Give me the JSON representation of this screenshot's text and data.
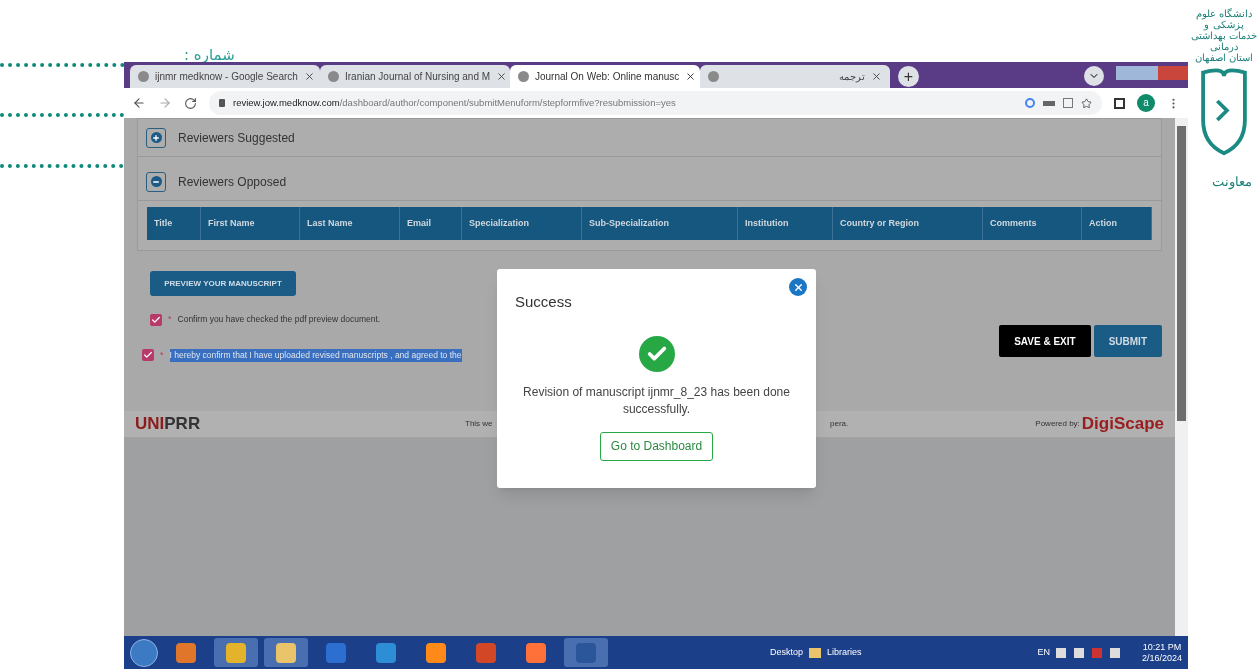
{
  "letterhead": {
    "number_label": "شماره :",
    "logo_lines": [
      "دانشگاه علوم پزشکی و خدمات بهداشتی درمانی",
      "استان اصفهان"
    ],
    "side_text": "معاونت"
  },
  "browser": {
    "tabs": [
      {
        "title": "ijnmr medknow - Google Search",
        "selected": false
      },
      {
        "title": "Iranian Journal of Nursing and M",
        "selected": false
      },
      {
        "title": "Journal On Web: Online manusc",
        "selected": true
      },
      {
        "title": "ترجمه",
        "selected": false
      }
    ],
    "new_tab": "+",
    "url_domain": "review.jow.medknow.com",
    "url_path": "/dashboard/author/component/submitMenuform/stepformfive?resubmission=yes",
    "profile": "a"
  },
  "page": {
    "sections": [
      {
        "title": "Reviewers Suggested",
        "expanded": false
      },
      {
        "title": "Reviewers Opposed",
        "expanded": true
      }
    ],
    "table": {
      "columns": [
        "Title",
        "First Name",
        "Last Name",
        "Email",
        "Specialization",
        "Sub-Specialization",
        "Institution",
        "Country or Region",
        "Comments",
        "Action"
      ]
    },
    "preview_button": "PREVIEW YOUR MANUSCRIPT",
    "confirmations": [
      {
        "required_mark": "*",
        "text": "Confirm you have checked the pdf preview document.",
        "checked": true,
        "highlighted": false
      },
      {
        "required_mark": "*",
        "text": "I hereby confirm that I have uploaded revised manuscripts , and agreed to the",
        "checked": true,
        "highlighted": true
      }
    ],
    "buttons": [
      {
        "label": "SAVE & EXIT",
        "kind": "dark"
      },
      {
        "label": "SUBMIT",
        "kind": "primary"
      }
    ],
    "footer": {
      "logo_bold": "UNI",
      "logo_rest": "PRR",
      "text_left": "This we",
      "text_right": "pera.",
      "powered_label": "Powered by:",
      "powered_brand": "DigiScape"
    }
  },
  "modal": {
    "title": "Success",
    "message": "Revision of manuscript ijnmr_8_23 has been done successfully.",
    "button": "Go to Dashboard"
  },
  "taskbar": {
    "desktop": "Desktop",
    "libraries": "Libraries",
    "language": "EN",
    "time": "10:21 PM",
    "date": "2/16/2024"
  }
}
